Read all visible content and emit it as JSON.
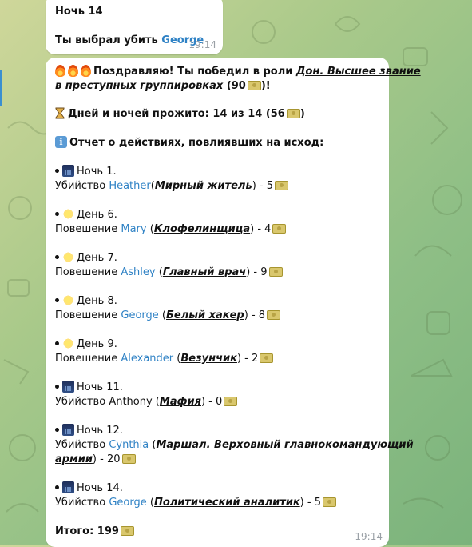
{
  "chat": {
    "message1": {
      "line1": "Ночь 14",
      "line2_prefix": "Ты выбрал убить ",
      "line2_name": "George",
      "time": "19:14"
    },
    "message2": {
      "header": {
        "text": "Поздравляю! Ты победил в роли ",
        "role_part1": "Дон. Высшее звание",
        "role_part2": "в преступных группировках",
        "score": " (90",
        "score_end": ")!"
      },
      "days": {
        "text": "Дней и ночей прожито: 14 из 14 (56",
        "end": ")"
      },
      "report": {
        "text": "Отчет о действиях, повлиявших на исход:"
      },
      "events": [
        {
          "phase": "Ночь 1.",
          "icon": "night-city-icon",
          "action": "Убийство ",
          "name": "Heather",
          "role": "Мирный житель",
          "points": " - 5"
        },
        {
          "phase": "День 6.",
          "icon": "sun-icon",
          "action": "Повешение ",
          "name": "Mary",
          "role": "Клофелинщица",
          "points": " - 4"
        },
        {
          "phase": "День 7.",
          "icon": "sun-icon",
          "action": "Повешение ",
          "name": "Ashley",
          "role": "Главный врач",
          "points": " - 9"
        },
        {
          "phase": "День 8.",
          "icon": "sun-icon",
          "action": "Повешение ",
          "name": "George",
          "role": "Белый хакер",
          "points": " - 8"
        },
        {
          "phase": "День 9.",
          "icon": "sun-icon",
          "action": "Повешение ",
          "name": "Alexander",
          "role": "Везунчик",
          "points": " - 2"
        },
        {
          "phase": "Ночь 11.",
          "icon": "night-city-icon",
          "action": "Убийство ",
          "name": "Anthony",
          "role": "Мафия",
          "points": " - 0"
        },
        {
          "phase": "Ночь 12.",
          "icon": "night-city-icon",
          "action": "Убийство ",
          "name": "Cynthia",
          "role_part1": "Маршал. Верховный главнокомандующий",
          "role_part2": "армии",
          "points": " - 20"
        },
        {
          "phase": "Ночь 14.",
          "icon": "night-city-icon",
          "action": "Убийство ",
          "name": "George",
          "role": "Политический аналитик",
          "points": " - 5"
        }
      ],
      "total": {
        "text": "Итого: 199"
      },
      "time": "19:14"
    }
  },
  "colors": {
    "username": "#2f82c5",
    "timestamp": "#9aa0a6",
    "bubble": "#ffffff"
  }
}
